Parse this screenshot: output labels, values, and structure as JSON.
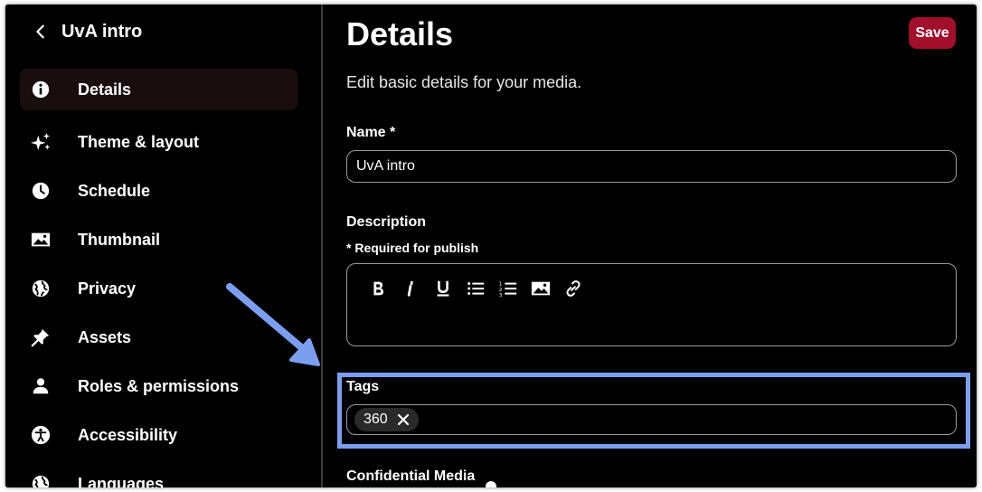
{
  "sidebar": {
    "back_title": "UvA intro",
    "items": [
      {
        "label": "Details",
        "icon": "info-icon",
        "active": true
      },
      {
        "label": "Theme & layout",
        "icon": "sparkles-icon"
      },
      {
        "label": "Schedule",
        "icon": "clock-icon"
      },
      {
        "label": "Thumbnail",
        "icon": "image-icon"
      },
      {
        "label": "Privacy",
        "icon": "globe-icon"
      },
      {
        "label": "Assets",
        "icon": "pin-icon"
      },
      {
        "label": "Roles & permissions",
        "icon": "person-icon"
      },
      {
        "label": "Accessibility",
        "icon": "accessibility-icon"
      },
      {
        "label": "Languages",
        "icon": "globe-icon"
      }
    ]
  },
  "main": {
    "title": "Details",
    "save_label": "Save",
    "subtitle": "Edit basic details for your media.",
    "name": {
      "label": "Name *",
      "value": "UvA intro"
    },
    "description": {
      "label": "Description",
      "note": "* Required for publish"
    },
    "tags": {
      "label": "Tags",
      "chips": [
        "360"
      ]
    },
    "confidential_label": "Confidential Media"
  },
  "colors": {
    "background": "#000000",
    "save_button": "#a10f2b",
    "highlight": "#7b9ff0",
    "active_item_bg": "#1a0d0e"
  }
}
